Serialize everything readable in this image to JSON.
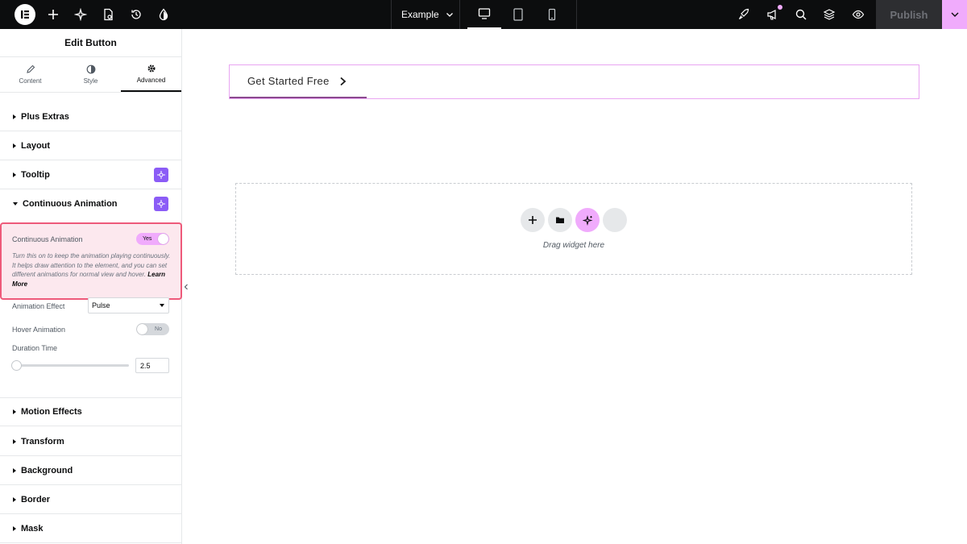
{
  "topbar": {
    "document_name": "Example",
    "publish_label": "Publish"
  },
  "panel": {
    "title": "Edit Button",
    "tabs": [
      {
        "label": "Content",
        "icon": "pencil-icon"
      },
      {
        "label": "Style",
        "icon": "half-circle-icon"
      },
      {
        "label": "Advanced",
        "icon": "gear-icon",
        "active": true
      }
    ],
    "sections_top": [
      "Plus Extras",
      "Layout",
      "Tooltip"
    ],
    "open_section": "Continuous Animation",
    "continuous_animation": {
      "label": "Continuous Animation",
      "toggle_value": "Yes",
      "description": "Turn this on to keep the animation playing continuously. It helps draw attention to the element, and you can set different animations for normal view and hover.",
      "learn_more": "Learn More",
      "effect_label": "Animation Effect",
      "effect_value": "Pulse",
      "hover_label": "Hover Animation",
      "hover_value": "No",
      "duration_label": "Duration Time",
      "duration_value": "2.5"
    },
    "sections_bottom": [
      "Motion Effects",
      "Transform",
      "Background",
      "Border",
      "Mask"
    ]
  },
  "canvas": {
    "button_text": "Get Started Free",
    "drop_label": "Drag widget here"
  },
  "colors": {
    "accent_pink": "#f0abfc",
    "pro_purple": "#8b5cf6",
    "highlight_border": "#ee5a7a"
  }
}
